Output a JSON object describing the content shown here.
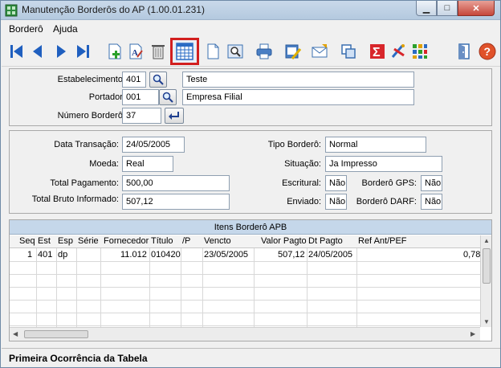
{
  "window": {
    "title": "Manutenção Borderôs do AP (1.00.01.231)"
  },
  "title_buttons": {
    "minimize": "▁",
    "maximize": "□",
    "close": "✕"
  },
  "menu": [
    {
      "label": "Borderô"
    },
    {
      "label": "Ajuda"
    }
  ],
  "toolbar": {
    "icons": [
      "first-icon",
      "previous-icon",
      "next-icon",
      "last-icon",
      "add-record-icon",
      "edit-record-icon",
      "delete-record-icon",
      "calendar-grid-icon",
      "new-document-icon",
      "preview-icon",
      "print-icon",
      "edit-report-icon",
      "send-mail-icon",
      "copy-icon",
      "sum-icon",
      "tools-icon",
      "grid-config-icon",
      "exit-icon",
      "help-icon"
    ],
    "selected": "calendar-grid-icon"
  },
  "header": {
    "estabelecimento_label": "Estabelecimento:",
    "estabelecimento_code": "401",
    "estabelecimento_name": "Teste",
    "portador_label": "Portador:",
    "portador_code": "001",
    "portador_name": "Empresa Filial",
    "numero_label": "Número Borderô:",
    "numero_value": "37"
  },
  "details": {
    "data_transacao_label": "Data Transação:",
    "data_transacao": "24/05/2005",
    "moeda_label": "Moeda:",
    "moeda": "Real",
    "total_pagamento_label": "Total Pagamento:",
    "total_pagamento": "500,00",
    "total_bruto_label": "Total Bruto Informado:",
    "total_bruto": "507,12",
    "tipo_bordero_label": "Tipo Borderô:",
    "tipo_bordero": "Normal",
    "situacao_label": "Situação:",
    "situacao": "Ja Impresso",
    "escritural_label": "Escritural:",
    "escritural": "Não",
    "enviado_label": "Enviado:",
    "enviado": "Não",
    "bordero_gps_label": "Borderô GPS:",
    "bordero_gps": "Não",
    "bordero_darf_label": "Borderô DARF:",
    "bordero_darf": "Não"
  },
  "grid": {
    "title": "Itens Borderô APB",
    "columns": [
      "Seq",
      "Est",
      "Esp",
      "Série",
      "Fornecedor",
      "Título",
      "/P",
      "Vencto",
      "Valor Pagto",
      "Dt Pagto",
      "Ref Ant/PEF"
    ],
    "rows": [
      [
        "1",
        "401",
        "dp",
        "",
        "11.012",
        "010420",
        "",
        "23/05/2005",
        "507,12",
        "24/05/2005",
        "",
        "0,78"
      ]
    ]
  },
  "status": {
    "text": "Primeira Ocorrência da Tabela"
  },
  "colors": {
    "selection_border": "#d21f1f",
    "grid_title_bg": "#c5d7ea",
    "nav_arrow": "#1f5fbf"
  }
}
